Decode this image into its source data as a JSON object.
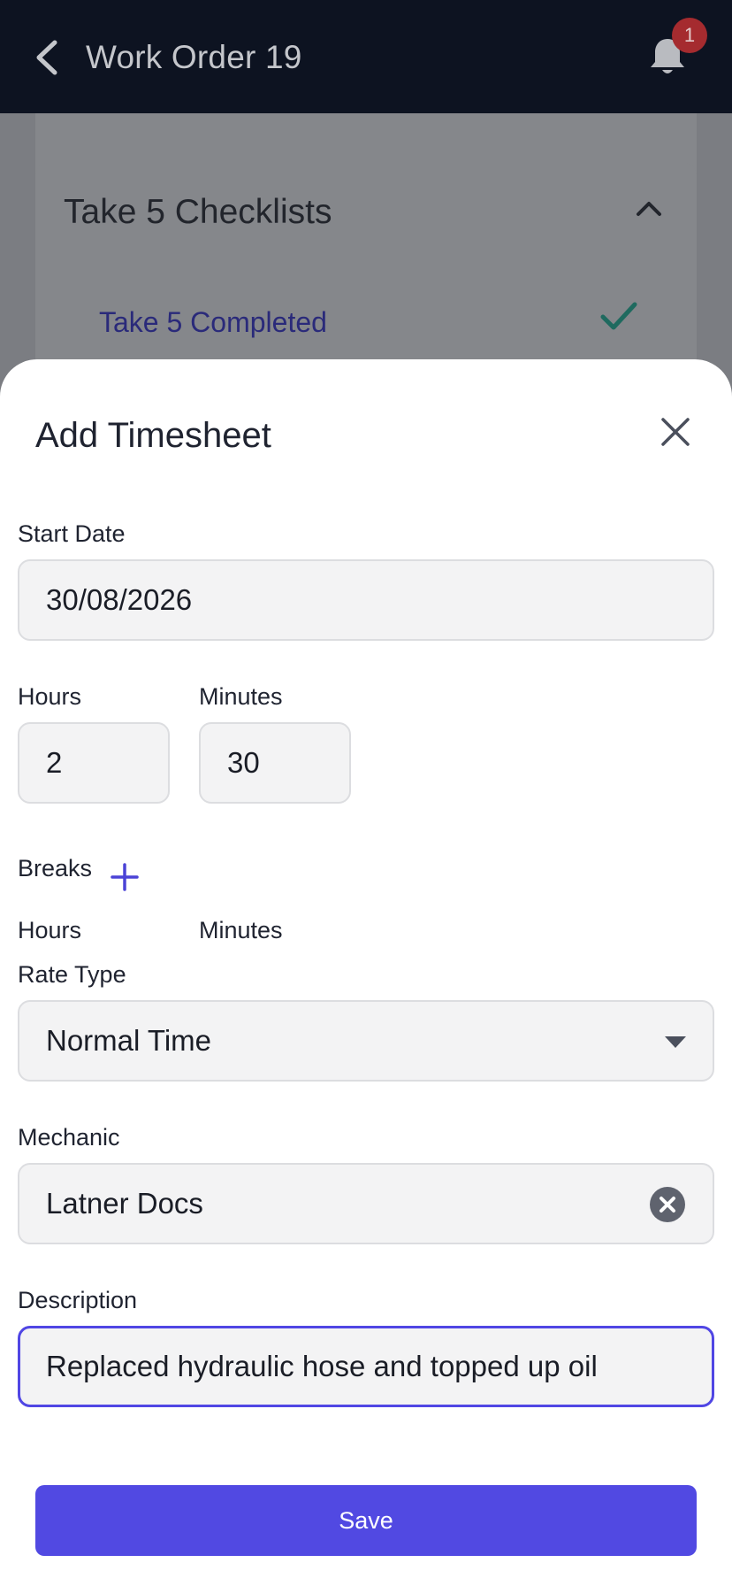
{
  "appbar": {
    "title": "Work Order 19",
    "notification_count": "1",
    "colors": {
      "background": "#0d1321",
      "badge": "#a52b2f"
    }
  },
  "background": {
    "card_title": "Take 5 Checklists",
    "item_label": "Take 5 Completed",
    "item_status": "completed"
  },
  "sheet": {
    "title": "Add Timesheet",
    "start_date": {
      "label": "Start Date",
      "value": "30/08/2026"
    },
    "hours": {
      "label": "Hours",
      "value": "2"
    },
    "minutes": {
      "label": "Minutes",
      "value": "30"
    },
    "breaks": {
      "label": "Breaks",
      "hours_label": "Hours",
      "minutes_label": "Minutes"
    },
    "rate_type": {
      "label": "Rate Type",
      "value": "Normal Time"
    },
    "mechanic": {
      "label": "Mechanic",
      "value": "Latner Docs"
    },
    "description": {
      "label": "Description",
      "value": "Replaced hydraulic hose and topped up oil"
    },
    "save_label": "Save",
    "colors": {
      "accent": "#5149e2",
      "field_bg": "#f3f3f4"
    }
  },
  "icons": [
    "chevron-left-icon",
    "bell-icon",
    "chevron-up-icon",
    "check-icon",
    "close-icon",
    "plus-icon",
    "caret-down-icon",
    "clear-circle-icon"
  ]
}
